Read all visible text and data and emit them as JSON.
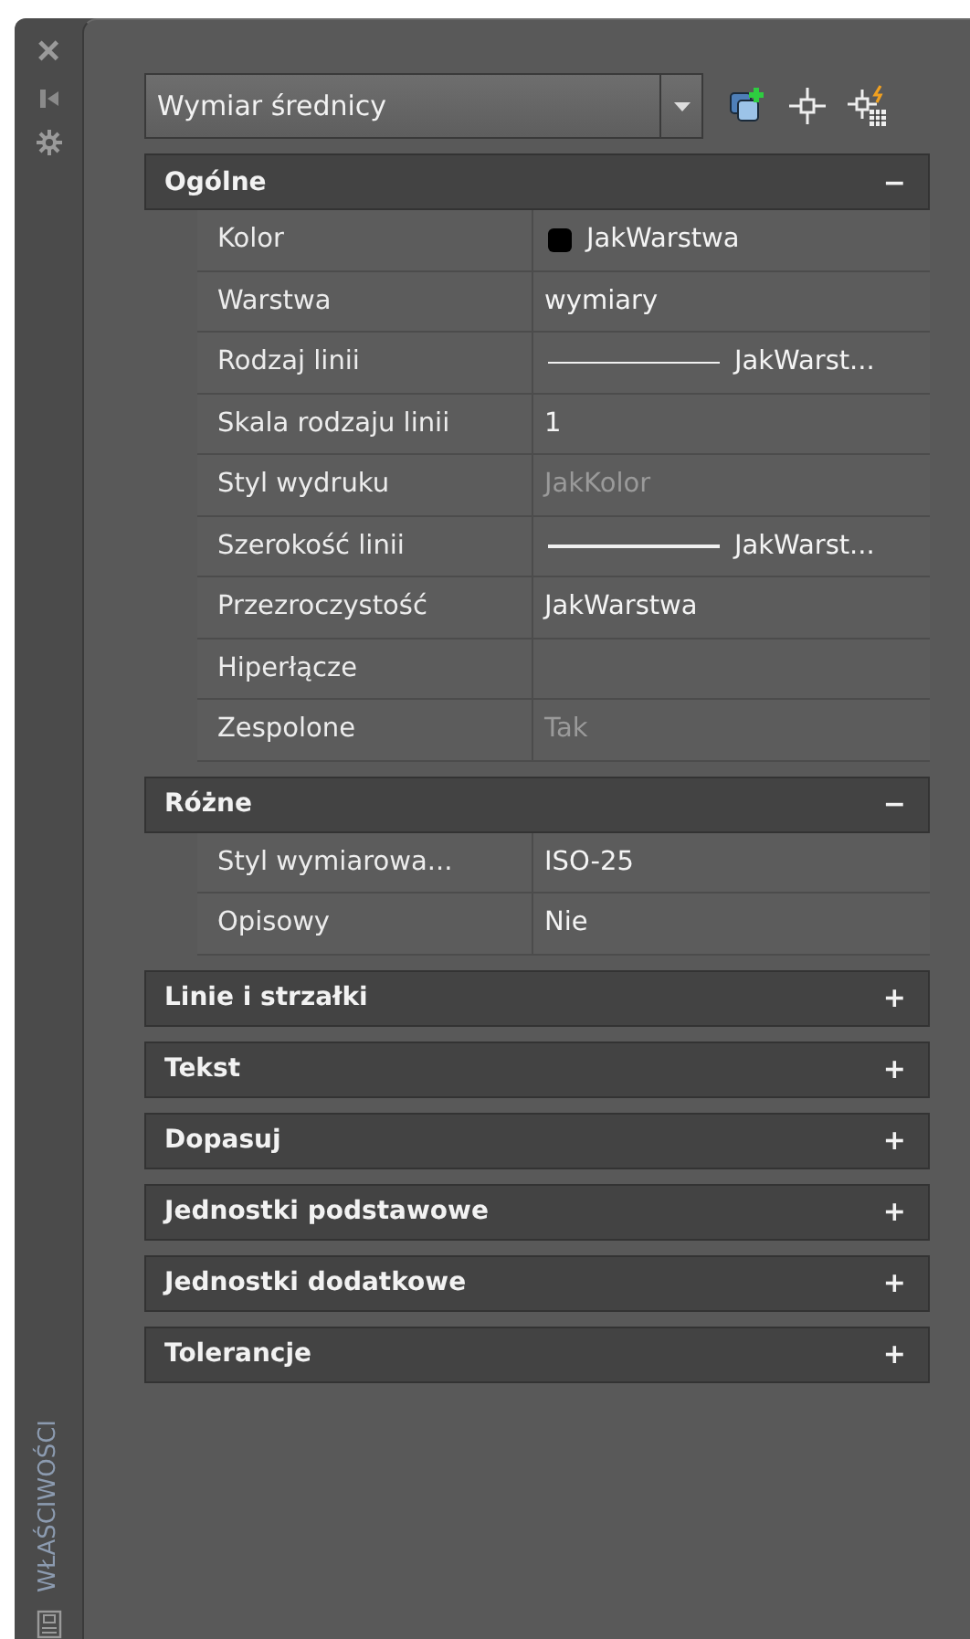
{
  "side_strip": {
    "close": "×",
    "title": "WŁAŚCIWOŚCI"
  },
  "selector": {
    "value": "Wymiar średnicy"
  },
  "sections": [
    {
      "title": "Ogólne",
      "toggle": "−",
      "expanded": true,
      "rows": [
        {
          "label": "Kolor",
          "kind": "color",
          "value": "JakWarstwa",
          "color": "#000000",
          "disabled": false
        },
        {
          "label": "Warstwa",
          "kind": "text",
          "value": "wymiary",
          "disabled": false
        },
        {
          "label": "Rodzaj linii",
          "kind": "line",
          "value": "JakWarst...",
          "disabled": false
        },
        {
          "label": "Skala rodzaju linii",
          "kind": "text",
          "value": "1",
          "disabled": false
        },
        {
          "label": "Styl wydruku",
          "kind": "text",
          "value": "JakKolor",
          "disabled": true
        },
        {
          "label": "Szerokość linii",
          "kind": "line",
          "value": "JakWarst...",
          "disabled": false
        },
        {
          "label": "Przezroczystość",
          "kind": "text",
          "value": "JakWarstwa",
          "disabled": false
        },
        {
          "label": "Hiperłącze",
          "kind": "text"
        },
        {
          "label": "Zespolone",
          "kind": "text",
          "value": "Tak",
          "disabled": true
        }
      ]
    },
    {
      "title": "Różne",
      "toggle": "−",
      "expanded": true,
      "rows": [
        {
          "label": "Styl wymiarowa...",
          "kind": "text",
          "value": "ISO-25",
          "disabled": false
        },
        {
          "label": "Opisowy",
          "kind": "text",
          "value": "Nie",
          "disabled": false
        }
      ]
    },
    {
      "title": "Linie i strzałki",
      "toggle": "+",
      "expanded": false
    },
    {
      "title": "Tekst",
      "toggle": "+",
      "expanded": false
    },
    {
      "title": "Dopasuj",
      "toggle": "+",
      "expanded": false
    },
    {
      "title": "Jednostki podstawowe",
      "toggle": "+",
      "expanded": false
    },
    {
      "title": "Jednostki dodatkowe",
      "toggle": "+",
      "expanded": false
    },
    {
      "title": "Tolerancje",
      "toggle": "+",
      "expanded": false
    }
  ]
}
